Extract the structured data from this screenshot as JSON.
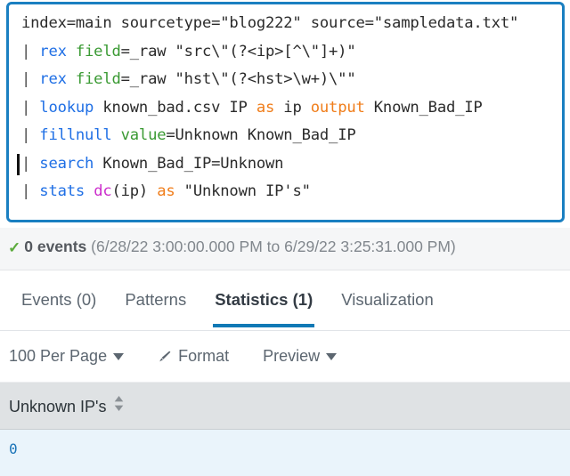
{
  "search_bar": {
    "name": "spl-search-query",
    "focused": true,
    "cursor_line_index": 5,
    "lines": [
      {
        "tokens": [
          {
            "text": "index=main sourcetype=\"blog222\" source=\"sampledata.txt\"",
            "type": "plain"
          }
        ]
      },
      {
        "tokens": [
          {
            "text": "| ",
            "type": "pipe"
          },
          {
            "text": "rex ",
            "type": "cmd"
          },
          {
            "text": "field",
            "type": "arg"
          },
          {
            "text": "=_raw \"src\\\"(?<ip>[^\\\"]+)\"",
            "type": "plain"
          }
        ]
      },
      {
        "tokens": [
          {
            "text": "| ",
            "type": "pipe"
          },
          {
            "text": "rex ",
            "type": "cmd"
          },
          {
            "text": "field",
            "type": "arg"
          },
          {
            "text": "=_raw \"hst\\\"(?<hst>\\w+)\\\"\"",
            "type": "plain"
          }
        ]
      },
      {
        "tokens": [
          {
            "text": "| ",
            "type": "pipe"
          },
          {
            "text": "lookup ",
            "type": "cmd"
          },
          {
            "text": "known_bad.csv IP ",
            "type": "plain"
          },
          {
            "text": "as",
            "type": "kw"
          },
          {
            "text": " ip ",
            "type": "plain"
          },
          {
            "text": "output",
            "type": "kw"
          },
          {
            "text": " Known_Bad_IP",
            "type": "plain"
          }
        ]
      },
      {
        "tokens": [
          {
            "text": "| ",
            "type": "pipe"
          },
          {
            "text": "fillnull ",
            "type": "cmd"
          },
          {
            "text": "value",
            "type": "arg"
          },
          {
            "text": "=Unknown Known_Bad_IP",
            "type": "plain"
          }
        ]
      },
      {
        "tokens": [
          {
            "text": "| ",
            "type": "pipe"
          },
          {
            "text": "search ",
            "type": "cmd"
          },
          {
            "text": "Known_Bad_IP=Unknown",
            "type": "plain"
          }
        ]
      },
      {
        "tokens": [
          {
            "text": "| ",
            "type": "pipe"
          },
          {
            "text": "stats ",
            "type": "cmd"
          },
          {
            "text": "dc",
            "type": "fn"
          },
          {
            "text": "(ip) ",
            "type": "plain"
          },
          {
            "text": "as",
            "type": "kw"
          },
          {
            "text": " \"Unknown IP's\"",
            "type": "plain"
          }
        ]
      }
    ]
  },
  "job_status": {
    "check_icon": "check-icon",
    "count_label": "0 events",
    "time_range": "(6/28/22 3:00:00.000 PM to 6/29/22 3:25:31.000 PM)"
  },
  "tabs": [
    {
      "label": "Events (0)",
      "name": "tab-events",
      "active": false
    },
    {
      "label": "Patterns",
      "name": "tab-patterns",
      "active": false
    },
    {
      "label": "Statistics (1)",
      "name": "tab-statistics",
      "active": true
    },
    {
      "label": "Visualization",
      "name": "tab-visualization",
      "active": false
    }
  ],
  "toolbar": {
    "per_page_label": "100 Per Page",
    "format_label": "Format",
    "format_icon": "brush-icon",
    "preview_label": "Preview"
  },
  "results_table": {
    "columns": [
      {
        "label": "Unknown IP's",
        "sort_icon": "sort-both-icon"
      }
    ],
    "rows": [
      {
        "cells": [
          "0"
        ]
      }
    ]
  },
  "colors": {
    "accent_blue": "#1179b5",
    "focus_border": "#1a7fc1",
    "command_blue": "#1f6fe5",
    "argument_green": "#3a9a33",
    "keyword_orange": "#f07d1a",
    "function_magenta": "#cc2fcc",
    "success_green": "#5cab3c",
    "row_highlight": "#eaf4fb",
    "header_gray": "#dfe2e4"
  }
}
